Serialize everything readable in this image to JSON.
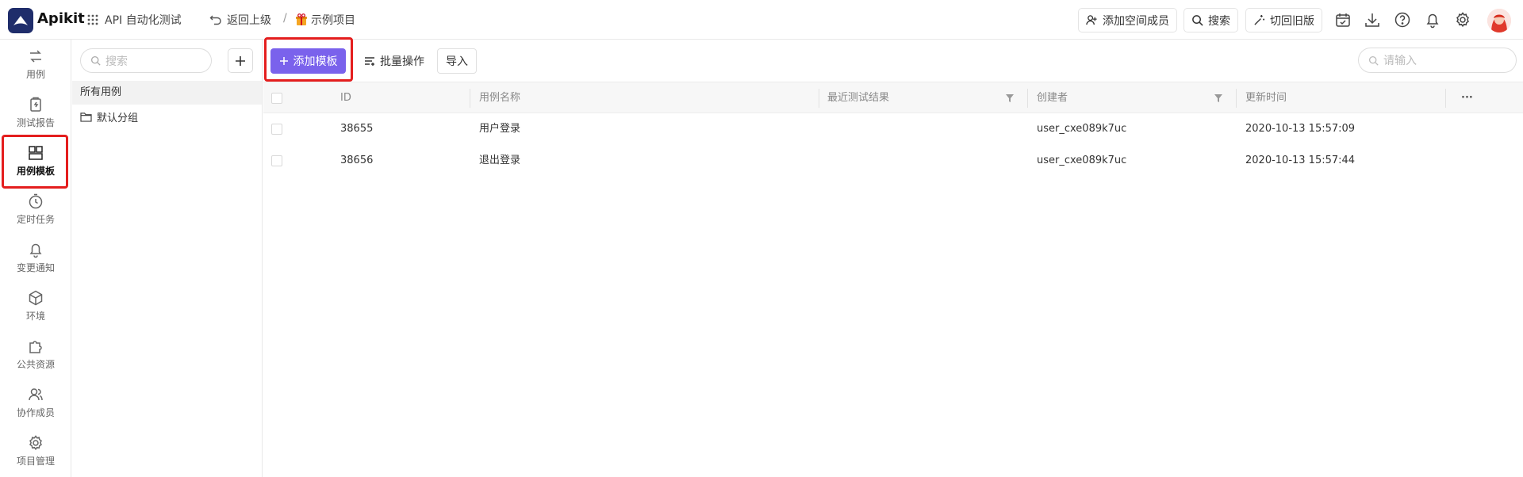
{
  "topbar": {
    "brand": "Apikit",
    "app_name": "API 自动化测试",
    "back_label": "返回上级",
    "separator": "/",
    "project_name": "示例项目",
    "add_member_label": "添加空间成员",
    "search_label": "搜索",
    "old_version_label": "切回旧版",
    "icons": [
      "calendar-icon",
      "download-icon",
      "help-icon",
      "bell-icon",
      "settings-icon"
    ]
  },
  "rail": {
    "items": [
      {
        "label": "用例",
        "icon": "case-icon"
      },
      {
        "label": "测试报告",
        "icon": "report-icon"
      },
      {
        "label": "用例模板",
        "icon": "template-icon",
        "active": true
      },
      {
        "label": "定时任务",
        "icon": "timer-icon"
      },
      {
        "label": "变更通知",
        "icon": "bell-icon"
      },
      {
        "label": "环境",
        "icon": "environment-icon"
      },
      {
        "label": "公共资源",
        "icon": "puzzle-icon"
      },
      {
        "label": "协作成员",
        "icon": "members-icon"
      },
      {
        "label": "项目管理",
        "icon": "gear-icon"
      }
    ]
  },
  "tree": {
    "search_placeholder": "搜索",
    "all_label": "所有用例",
    "folders": [
      "默认分组"
    ]
  },
  "toolbar": {
    "add_template_label": "添加模板",
    "batch_label": "批量操作",
    "import_label": "导入",
    "search_placeholder": "请输入"
  },
  "table": {
    "columns": [
      "ID",
      "用例名称",
      "最近测试结果",
      "创建者",
      "更新时间",
      "···"
    ],
    "rows": [
      {
        "id": "38655",
        "name": "用户登录",
        "result": "",
        "creator": "user_cxe089k7uc",
        "updated": "2020-10-13 15:57:09"
      },
      {
        "id": "38656",
        "name": "退出登录",
        "result": "",
        "creator": "user_cxe089k7uc",
        "updated": "2020-10-13 15:57:44"
      }
    ]
  },
  "colors": {
    "primary": "#7a62ec",
    "highlight": "#e41e1e",
    "logo_bg": "#1f2d6b"
  }
}
